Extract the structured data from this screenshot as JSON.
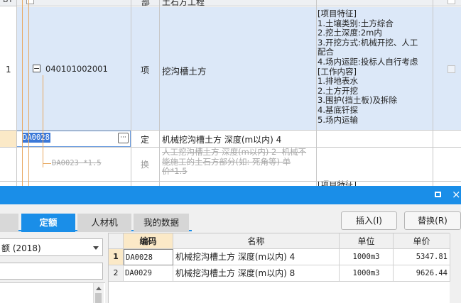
{
  "top_table": {
    "header": {
      "col_a": "BT",
      "col_unit": "部",
      "col_name": "土石方工程"
    },
    "row1": {
      "index": "1",
      "expand_symbol": "−",
      "code": "040101002001",
      "type": "项",
      "name": "挖沟槽土方",
      "features": [
        "[项目特征]",
        "1.土壤类别:土方综合",
        "2.挖土深度:2m内",
        "3.开挖方式:机械开挖、人工",
        "配合",
        "4.场内运距:投标人自行考虑",
        "[工作内容]",
        "1.排地表水",
        "2.土方开挖",
        "3.围护(挡土板)及拆除",
        "4.基底钎探",
        "5.场内运输"
      ]
    },
    "row2": {
      "code": "DA0028",
      "ellipsis": "···",
      "type": "定",
      "name": "机械挖沟槽土方 深度(m以内) 4"
    },
    "row3": {
      "code": "DA0023 *1.5",
      "type": "换",
      "name_lines": [
        "人工挖沟槽土方 深度(m以内) 2  机械不",
        "能施工的土石方部分(如: 死角等) 单",
        "价*1.5"
      ]
    },
    "row4_feature_fragment": "[项目特征]"
  },
  "dialog": {
    "header_color": "#1a8ee8",
    "maximize_icon": "□",
    "tabs": [
      {
        "label": "定额",
        "active": true
      },
      {
        "label": "人材机",
        "active": false
      },
      {
        "label": "我的数据",
        "active": false
      }
    ],
    "insert_button": "插入(I)",
    "replace_button": "替换(R)",
    "library_select": "额 (2018)",
    "results": {
      "columns": [
        "编码",
        "名称",
        "单位",
        "单价"
      ],
      "rows": [
        {
          "index": "1",
          "code": "DA0028",
          "name": "机械挖沟槽土方 深度(m以内) 4",
          "unit": "1000m3",
          "price": "5347.81"
        },
        {
          "index": "2",
          "code": "DA0029",
          "name": "机械挖沟槽土方 深度(m以内) 8",
          "unit": "1000m3",
          "price": "9626.44"
        }
      ]
    }
  }
}
